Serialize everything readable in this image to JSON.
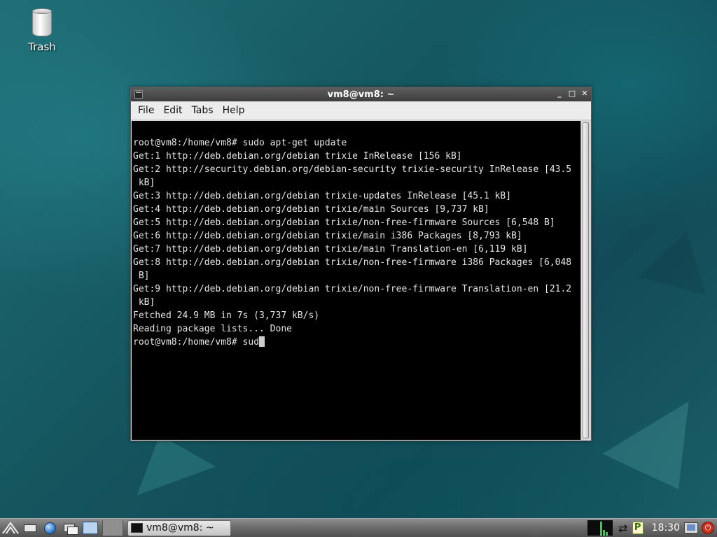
{
  "desktop": {
    "trash_label": "Trash"
  },
  "window": {
    "title": "vm8@vm8: ~",
    "controls": {
      "minimize": "_",
      "maximize": "□",
      "close": "✕"
    },
    "menu": [
      {
        "label": "File"
      },
      {
        "label": "Edit"
      },
      {
        "label": "Tabs"
      },
      {
        "label": "Help"
      }
    ],
    "terminal_lines": [
      "root@vm8:/home/vm8# sudo apt-get update",
      "Get:1 http://deb.debian.org/debian trixie InRelease [156 kB]",
      "Get:2 http://security.debian.org/debian-security trixie-security InRelease [43.5",
      " kB]",
      "Get:3 http://deb.debian.org/debian trixie-updates InRelease [45.1 kB]",
      "Get:4 http://deb.debian.org/debian trixie/main Sources [9,737 kB]",
      "Get:5 http://deb.debian.org/debian trixie/non-free-firmware Sources [6,548 B]",
      "Get:6 http://deb.debian.org/debian trixie/main i386 Packages [8,793 kB]",
      "Get:7 http://deb.debian.org/debian trixie/main Translation-en [6,119 kB]",
      "Get:8 http://deb.debian.org/debian trixie/non-free-firmware i386 Packages [6,048",
      " B]",
      "Get:9 http://deb.debian.org/debian trixie/non-free-firmware Translation-en [21.2",
      " kB]",
      "Fetched 24.9 MB in 7s (3,737 kB/s)",
      "Reading package lists... Done"
    ],
    "prompt": "root@vm8:/home/vm8# ",
    "current_input": "sud"
  },
  "taskbar": {
    "task_label": "vm8@vm8: ~",
    "clock": "18:30",
    "tray_p_label": "P"
  },
  "icons": {
    "start": "lxde-start-icon",
    "file_manager": "file-manager-icon",
    "browser": "web-browser-icon",
    "show_desktop": "show-desktop-icon",
    "desktop_pager": "desktop-pager-icon",
    "network": "network-monitor-icon",
    "arrows": "network-arrows-icon",
    "power": "power-icon"
  }
}
